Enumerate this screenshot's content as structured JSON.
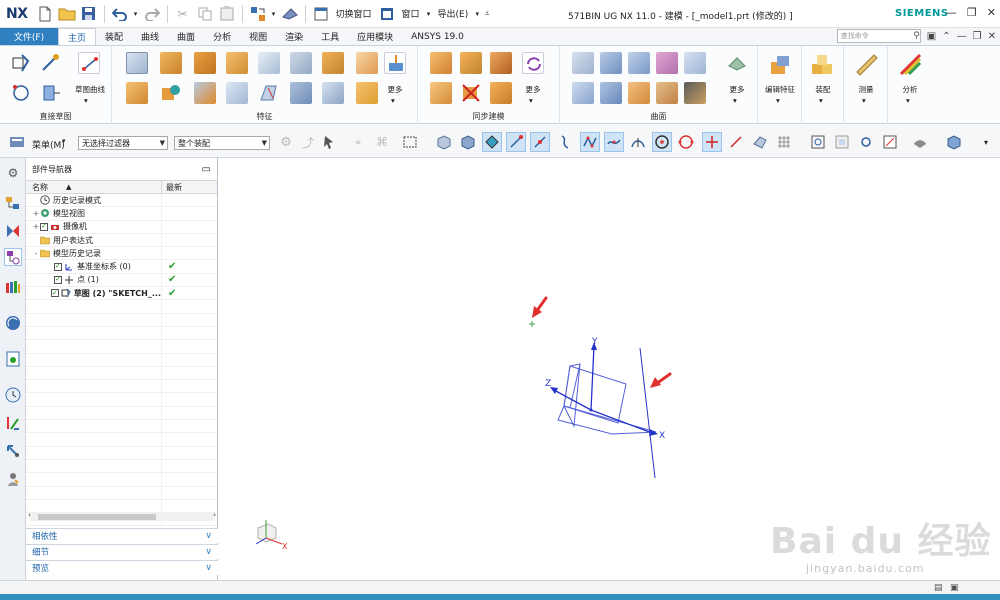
{
  "app": {
    "logo": "NX",
    "window_title": "571BIN UG NX 11.0 - 建模 - [_model1.prt  (修改的) ]",
    "brand": "SIEMENS",
    "switch_window": "切换窗口",
    "window_menu": "窗口",
    "export_menu": "导出(E)"
  },
  "ribbon_tabs": {
    "file": "文件(F)",
    "items": [
      "主页",
      "装配",
      "曲线",
      "曲面",
      "分析",
      "视图",
      "渲染",
      "工具",
      "应用模块",
      "ANSYS 19.0"
    ],
    "active_index": 0,
    "search_placeholder": "查找命令"
  },
  "ribbon_groups": {
    "direct_sketch": "直接草图",
    "sketch_curve": "草图曲线",
    "feature": "特征",
    "sync_modeling": "同步建模",
    "surface": "曲面",
    "more": "更多",
    "edit_feature": "编辑特征",
    "assembly": "装配",
    "measure": "测量",
    "analysis": "分析"
  },
  "selection_bar": {
    "menu": "菜单(M)",
    "filter": "无选择过滤器",
    "scope": "整个装配"
  },
  "navigator": {
    "title": "部件导航器",
    "col_name": "名称",
    "col_latest": "最新",
    "rows": [
      {
        "indent": 0,
        "expander": "",
        "icon": "clock-icon",
        "check": false,
        "label": "历史记录模式",
        "latest": ""
      },
      {
        "indent": 0,
        "expander": "+",
        "icon": "model-views-icon",
        "check": false,
        "label": "模型视图",
        "latest": ""
      },
      {
        "indent": 0,
        "expander": "+",
        "icon": "camera-icon",
        "check": true,
        "label": "摄像机",
        "latest": ""
      },
      {
        "indent": 0,
        "expander": "",
        "icon": "folder-icon",
        "check": false,
        "label": "用户表达式",
        "latest": ""
      },
      {
        "indent": 0,
        "expander": "-",
        "icon": "folder-icon",
        "check": false,
        "label": "模型历史记录",
        "latest": ""
      },
      {
        "indent": 1,
        "expander": "",
        "icon": "datum-csys-icon",
        "check": true,
        "label": "基准坐标系 (0)",
        "latest": "✔"
      },
      {
        "indent": 1,
        "expander": "",
        "icon": "point-icon",
        "check": true,
        "label": "点 (1)",
        "latest": "✔"
      },
      {
        "indent": 1,
        "expander": "",
        "icon": "sketch-icon",
        "check": true,
        "label": "草图 (2) \"SKETCH_...",
        "latest": "✔"
      }
    ],
    "sections": [
      "相依性",
      "细节",
      "预览"
    ]
  },
  "viewport": {
    "axis_x": "X",
    "axis_y": "Y",
    "axis_z": "Z",
    "triad_x": "X"
  },
  "watermark": {
    "main": "Bai du 经验",
    "sub": "jingyan.baidu.com"
  },
  "colors": {
    "accent": "#2f7fc1",
    "axis": "#2633c9",
    "arrow_annotation": "#e03030",
    "check_green": "#2ca02c"
  }
}
